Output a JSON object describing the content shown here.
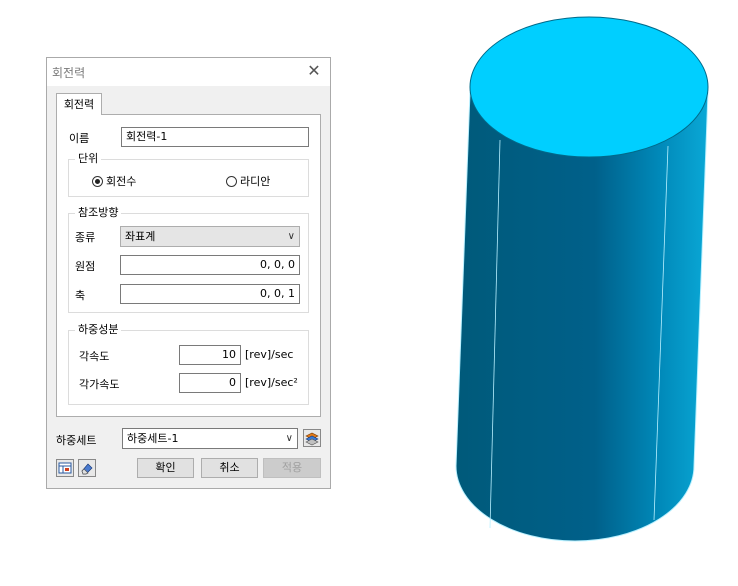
{
  "dialog": {
    "title": "회전력",
    "close_glyph": "✕",
    "tab_label": "회전력",
    "name_label": "이름",
    "name_value": "회전력-1",
    "unit_group": {
      "label": "단위",
      "option_rev": "회전수",
      "option_rad": "라디안",
      "selected": "회전수"
    },
    "ref_group": {
      "label": "참조방향",
      "type_label": "종류",
      "type_value": "좌표계",
      "origin_label": "원점",
      "origin_value": "0, 0, 0",
      "axis_label": "축",
      "axis_value": "0, 0, 1"
    },
    "load_group": {
      "label": "하중성분",
      "ang_vel_label": "각속도",
      "ang_vel_value": "10",
      "ang_vel_unit": "[rev]/sec",
      "ang_acc_label": "각가속도",
      "ang_acc_value": "0",
      "ang_acc_unit": "[rev]/sec²"
    },
    "load_set_label": "하중세트",
    "load_set_value": "하중세트-1",
    "ok_label": "확인",
    "cancel_label": "취소",
    "apply_label": "적용"
  },
  "icons": {
    "load_set_manager": "layer-stack-icon",
    "bottom_left_1": "edit-table-icon",
    "bottom_left_2": "eraser-icon"
  },
  "viewport": {
    "model": "cylinder",
    "colors": {
      "top": "#00cfff",
      "side_dark": "#005a7a",
      "side_light": "#0aa8d6",
      "edge": "#b8f0ff"
    }
  }
}
